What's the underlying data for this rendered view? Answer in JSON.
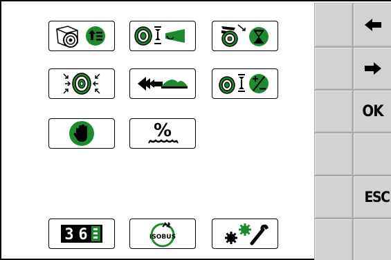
{
  "screen": {
    "accent_green": "#1e8a2e",
    "dark_green": "#0b5e17",
    "button_grey": "#d2d2d2"
  },
  "main_menu": {
    "icons": [
      {
        "name": "bale-size-icon"
      },
      {
        "name": "net-binding-icon"
      },
      {
        "name": "bale-timer-icon"
      },
      {
        "name": "bale-compression-icon"
      },
      {
        "name": "pickup-reverse-icon"
      },
      {
        "name": "bale-diameter-correction-icon"
      },
      {
        "name": "stop-hand-icon"
      },
      {
        "name": "moisture-percent-icon"
      },
      {
        "name": "counter-icon"
      },
      {
        "name": "isobus-icon"
      },
      {
        "name": "settings-service-icon"
      }
    ],
    "percent_symbol": "%",
    "counter_digits": [
      "3",
      "6"
    ],
    "isobus_label": "ISOBUS"
  },
  "softkeys": {
    "left_column": [
      {
        "label": ""
      },
      {
        "label": ""
      },
      {
        "label": ""
      },
      {
        "label": ""
      },
      {
        "label": ""
      },
      {
        "label": ""
      }
    ],
    "right_column": [
      {
        "icon": "arrow-left-icon",
        "label": ""
      },
      {
        "icon": "arrow-right-icon",
        "label": ""
      },
      {
        "label": "OK"
      },
      {
        "label": ""
      },
      {
        "label": "ESC"
      },
      {
        "label": ""
      }
    ]
  }
}
